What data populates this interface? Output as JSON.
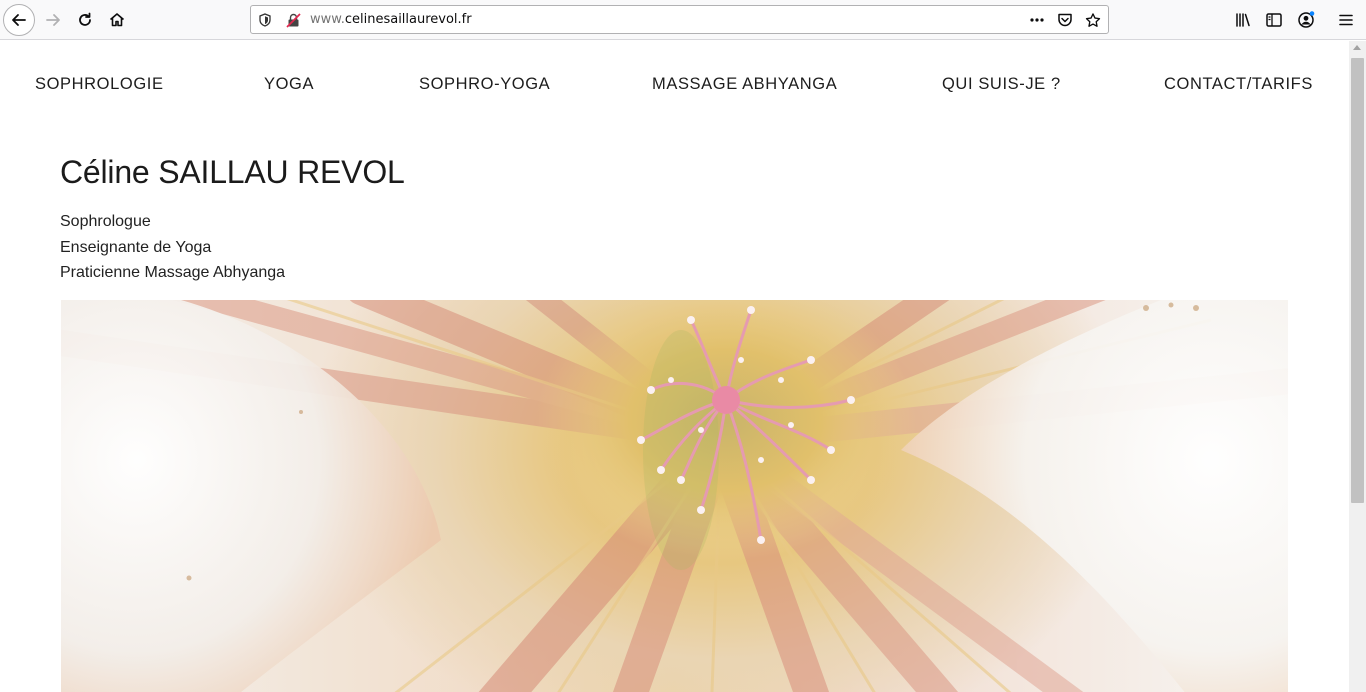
{
  "browser": {
    "url_host_prefix": "www.",
    "url_domain": "celinesaillaurevol.fr",
    "icons": [
      "back-arrow-icon",
      "forward-arrow-icon",
      "reload-icon",
      "home-icon",
      "shield-icon",
      "insecure-lock-icon",
      "more-icon",
      "pocket-icon",
      "star-icon",
      "library-icon",
      "sidebar-icon",
      "account-icon",
      "menu-icon"
    ]
  },
  "nav": {
    "items": [
      {
        "label": "SOPHROLOGIE"
      },
      {
        "label": "YOGA"
      },
      {
        "label": "SOPHRO-YOGA"
      },
      {
        "label": "MASSAGE ABHYANGA"
      },
      {
        "label": "QUI SUIS-JE ?"
      },
      {
        "label": "CONTACT/TARIFS"
      }
    ]
  },
  "header": {
    "title": "Céline SAILLAU REVOL",
    "roles": [
      "Sophrologue",
      "Enseignante de Yoga",
      "Praticienne Massage Abhyanga"
    ]
  },
  "hero": {
    "subject": "flower",
    "colors": {
      "petal": "#f4f1ee",
      "vein": "#d98c7c",
      "center": "#e8c36a",
      "stamen": "#f2a0b5"
    }
  }
}
